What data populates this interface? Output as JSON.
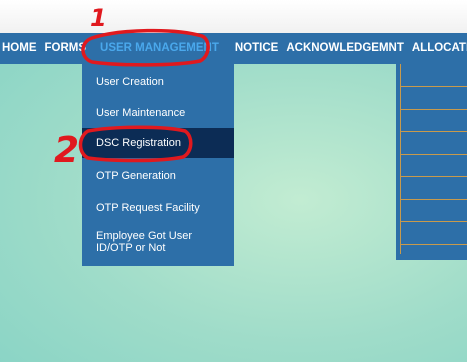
{
  "nav": {
    "items": [
      "HOME",
      "FORMS",
      "USER MANAGEMENT",
      "NOTICE",
      "ACKNOWLEDGEMNT",
      "ALLOCATE APPL"
    ],
    "active": "USER MANAGEMENT"
  },
  "dropdown": {
    "items": [
      {
        "label": "User Creation"
      },
      {
        "label": "User Maintenance"
      },
      {
        "label": "DSC Registration"
      },
      {
        "label": "OTP Generation"
      },
      {
        "label": "OTP Request Facility"
      },
      {
        "label": "Employee Got User ID/OTP or Not"
      }
    ],
    "selected": "DSC Registration"
  },
  "annotations": {
    "numbers": [
      "1",
      "2"
    ],
    "color": "#e0191e"
  },
  "colors": {
    "nav_bg": "#2d6fa8",
    "active_text": "#4aa8ec",
    "selected_bg": "#0c2c55",
    "panel_lines": "#c89a4c"
  }
}
